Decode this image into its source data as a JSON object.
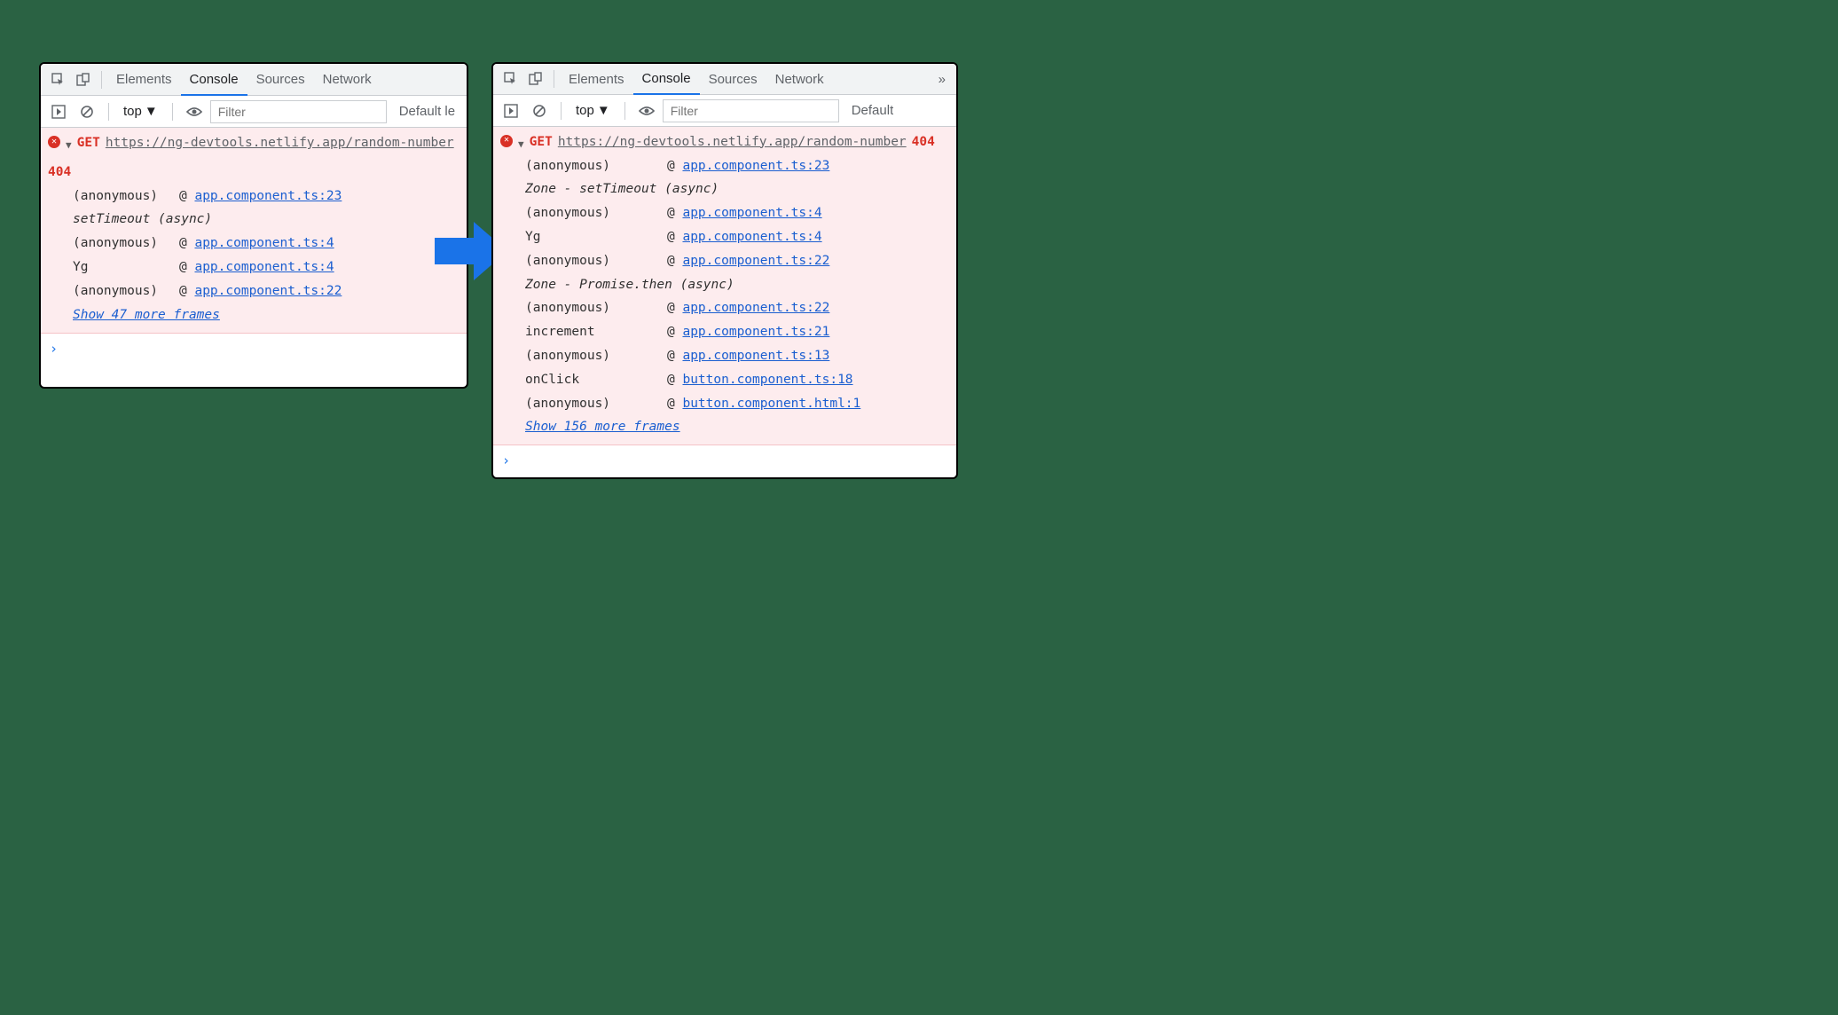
{
  "tabs": {
    "elements": "Elements",
    "console": "Console",
    "sources": "Sources",
    "network": "Network",
    "more": "»"
  },
  "toolbar": {
    "context": "top",
    "filter_placeholder": "Filter",
    "levels_left": "Default le",
    "levels_right": "Default"
  },
  "left": {
    "method": "GET",
    "url": "https://ng-devtools.netlify.app/random-number",
    "status": "404",
    "section1": "setTimeout (async)",
    "stack": [
      {
        "fn": "(anonymous)",
        "loc": "app.component.ts:23"
      },
      {
        "fn": "(anonymous)",
        "loc": "app.component.ts:4"
      },
      {
        "fn": "Yg",
        "loc": "app.component.ts:4"
      },
      {
        "fn": "(anonymous)",
        "loc": "app.component.ts:22"
      }
    ],
    "show_more": "Show 47 more frames"
  },
  "right": {
    "method": "GET",
    "url": "https://ng-devtools.netlify.app/random-number",
    "status": "404",
    "section1": "Zone - setTimeout (async)",
    "section2": "Zone - Promise.then (async)",
    "stack1": [
      {
        "fn": "(anonymous)",
        "loc": "app.component.ts:23"
      }
    ],
    "stack2": [
      {
        "fn": "(anonymous)",
        "loc": "app.component.ts:4"
      },
      {
        "fn": "Yg",
        "loc": "app.component.ts:4"
      },
      {
        "fn": "(anonymous)",
        "loc": "app.component.ts:22"
      }
    ],
    "stack3": [
      {
        "fn": "(anonymous)",
        "loc": "app.component.ts:22"
      },
      {
        "fn": "increment",
        "loc": "app.component.ts:21"
      },
      {
        "fn": "(anonymous)",
        "loc": "app.component.ts:13"
      },
      {
        "fn": "onClick",
        "loc": "button.component.ts:18"
      },
      {
        "fn": "(anonymous)",
        "loc": "button.component.html:1"
      }
    ],
    "show_more": "Show 156 more frames"
  },
  "prompt": "›"
}
